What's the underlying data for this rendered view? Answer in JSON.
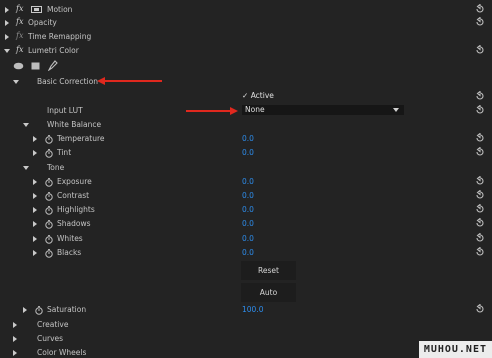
{
  "effects": {
    "motion_label": "Motion",
    "opacity_label": "Opacity",
    "time_remapping_label": "Time Remapping",
    "lumetri_label": "Lumetri Color",
    "fx_glyph": "fx"
  },
  "lumetri": {
    "mask_tools": [
      "ellipse-mask-icon",
      "rectangle-mask-icon",
      "pen-mask-icon"
    ],
    "basic_correction_label": "Basic Correction",
    "active_label": "Active",
    "active_checked": true,
    "input_lut_label": "Input LUT",
    "input_lut_value": "None",
    "white_balance_label": "White Balance",
    "temperature_label": "Temperature",
    "temperature_value": "0.0",
    "tint_label": "Tint",
    "tint_value": "0.0",
    "tone_label": "Tone",
    "tone_params": [
      {
        "label": "Exposure",
        "value": "0.0"
      },
      {
        "label": "Contrast",
        "value": "0.0"
      },
      {
        "label": "Highlights",
        "value": "0.0"
      },
      {
        "label": "Shadows",
        "value": "0.0"
      },
      {
        "label": "Whites",
        "value": "0.0"
      },
      {
        "label": "Blacks",
        "value": "0.0"
      }
    ],
    "reset_button": "Reset",
    "auto_button": "Auto",
    "saturation_label": "Saturation",
    "saturation_value": "100.0",
    "creative_label": "Creative",
    "curves_label": "Curves",
    "color_wheels_label": "Color Wheels"
  },
  "watermark": "MUHOU.NET",
  "colors": {
    "background": "#232323",
    "value_blue": "#2d8ceb",
    "annotation_red": "#e0281e"
  }
}
